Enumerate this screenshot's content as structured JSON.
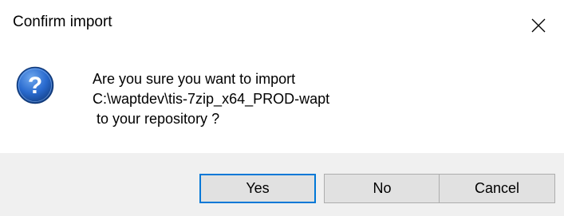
{
  "dialog": {
    "title": "Confirm import",
    "message_line1": "Are you sure you want to import",
    "message_line2": "C:\\waptdev\\tis-7zip_x64_PROD-wapt",
    "message_line3": " to your repository ?",
    "icon": "question-icon",
    "close_icon": "close-icon"
  },
  "buttons": {
    "yes_label": "Yes",
    "no_label": "No",
    "cancel_label": "Cancel"
  },
  "colors": {
    "accent": "#0078d7",
    "button_bar": "#f0f0f0",
    "button_face": "#e1e1e1",
    "icon_blue": "#1f5fb4"
  }
}
